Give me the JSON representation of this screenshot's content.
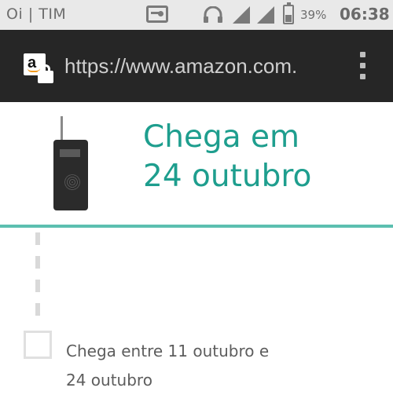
{
  "status_bar": {
    "carrier": "Oi | TIM",
    "battery": "39%",
    "time": "06:38",
    "icons": [
      "radio-icon",
      "headset-icon",
      "signal-icon",
      "battery-icon"
    ]
  },
  "browser": {
    "url": "https://www.amazon.com.",
    "site_icon": "amazon-a-icon",
    "secure_icon": "lock-icon",
    "menu_icon": "overflow-menu-icon"
  },
  "delivery": {
    "headline_line1": "Chega em",
    "headline_line2": "24 outubro",
    "product_image": "portable-radio",
    "estimate_line1": "Chega entre 11 outubro e",
    "estimate_line2": "24 outubro"
  },
  "colors": {
    "accent": "#1e9e8e",
    "divider": "#5cbfb0",
    "toolbar": "#262626",
    "status_bar": "#e9e9e9"
  }
}
